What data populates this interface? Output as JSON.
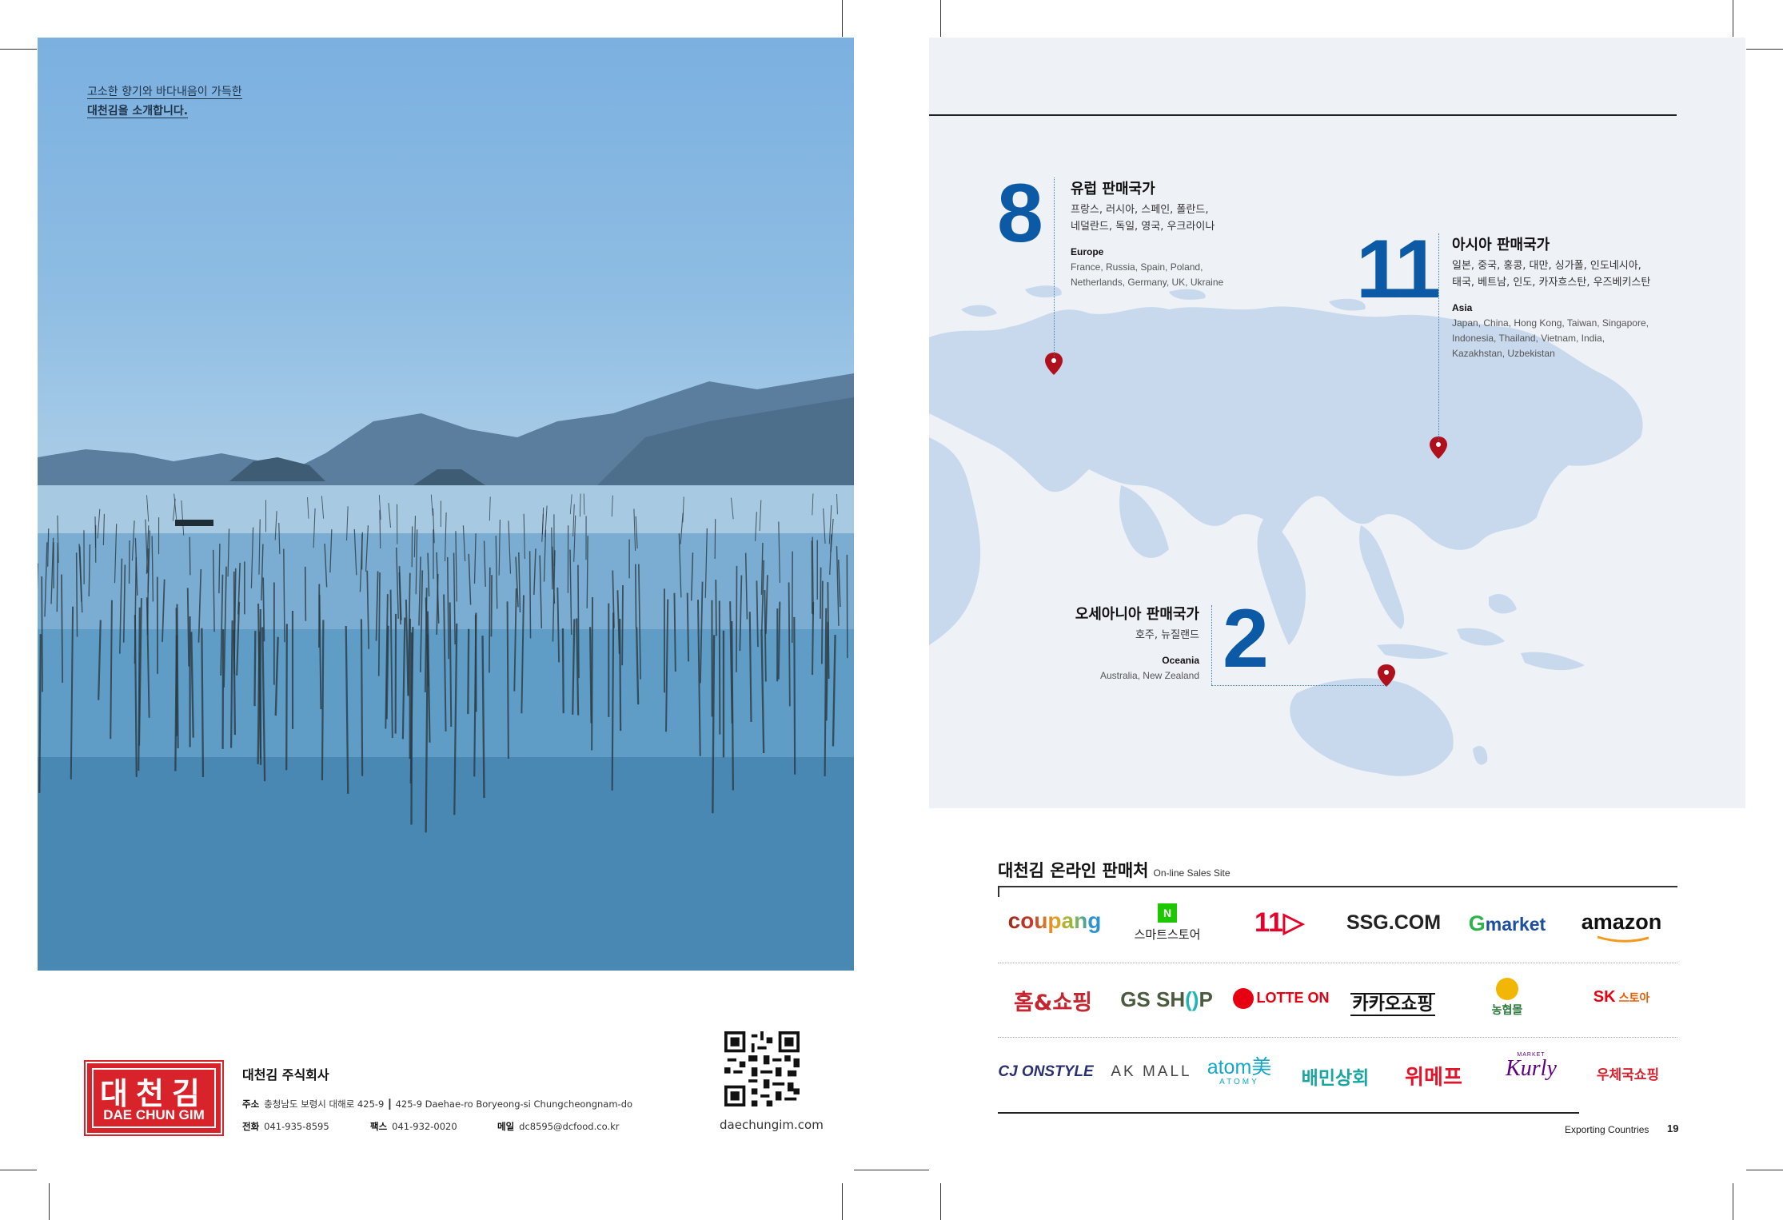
{
  "left_page": {
    "intro_line1": "고소한 향기와 바다내음이 가득한",
    "intro_line2": "대천김을 소개합니다.",
    "logo_ko": "대천김",
    "logo_en": "DAE CHUN GIM",
    "company_name": "대천김 주식회사",
    "address_label": "주소",
    "address": "충청남도 보령시 대해로 425-9 ┃ 425-9 Daehae-ro Boryeong-si Chungcheongnam-do",
    "phone_label": "전화",
    "phone": "041-935-8595",
    "fax_label": "팩스",
    "fax": "041-932-0020",
    "mail_label": "메일",
    "mail": "dc8595@dcfood.co.kr",
    "website": "daechungim.com"
  },
  "map": {
    "europe": {
      "count": "8",
      "title_ko": "유럽 판매국가",
      "list_ko_1": "프랑스, 러시아, 스페인, 폴란드,",
      "list_ko_2": "네덜란드, 독일, 영국, 우크라이나",
      "title_en": "Europe",
      "list_en_1": "France, Russia, Spain, Poland,",
      "list_en_2": "Netherlands, Germany, UK, Ukraine"
    },
    "asia": {
      "count": "11",
      "title_ko": "아시아 판매국가",
      "list_ko_1": "일본, 중국, 홍콩, 대만, 싱가폴, 인도네시아,",
      "list_ko_2": "태국, 베트남, 인도, 카자흐스탄, 우즈베키스탄",
      "title_en": "Asia",
      "list_en_1": "Japan, China, Hong Kong, Taiwan, Singapore,",
      "list_en_2": "Indonesia, Thailand, Vietnam, India,",
      "list_en_3": "Kazakhstan, Uzbekistan"
    },
    "oceania": {
      "count": "2",
      "title_ko": "오세아니아 판매국가",
      "list_ko_1": "호주, 뉴질랜드",
      "title_en": "Oceania",
      "list_en_1": "Australia, New Zealand"
    },
    "colors": {
      "number": "#0c5aa6",
      "pin": "#b0101c",
      "land": "#c8d9ee",
      "sea": "#eef2f7"
    }
  },
  "sales": {
    "title": "대천김 온라인 판매처",
    "subtitle": "On-line Sales Site",
    "row1": {
      "coupang": "coupang",
      "smartstore_label": "스마트스토어",
      "st11": "11",
      "ssg": "SSG.COM",
      "gmarket_g": "G",
      "gmarket_rest": "market",
      "amazon": "amazon"
    },
    "row2": {
      "homeshopping": "홈&쇼핑",
      "gsshop_a": "GS SH",
      "gsshop_b": "P",
      "lotteon": "LOTTE ON",
      "kakao": "카카오쇼핑",
      "nonghyup": "농협몰",
      "sk_a": "SK",
      "sk_b": "스토아"
    },
    "row3": {
      "cj": "CJ ONSTYLE",
      "ak": "AK MALL",
      "atomy_main": "atom美",
      "atomy_sub": "ATOMY",
      "baemin": "배민상회",
      "wemakeprice": "위메프",
      "kurly_small": "MARKET",
      "kurly": "Kurly",
      "post": "우체국쇼핑"
    }
  },
  "footer": {
    "section": "Exporting Countries",
    "page": "19"
  }
}
